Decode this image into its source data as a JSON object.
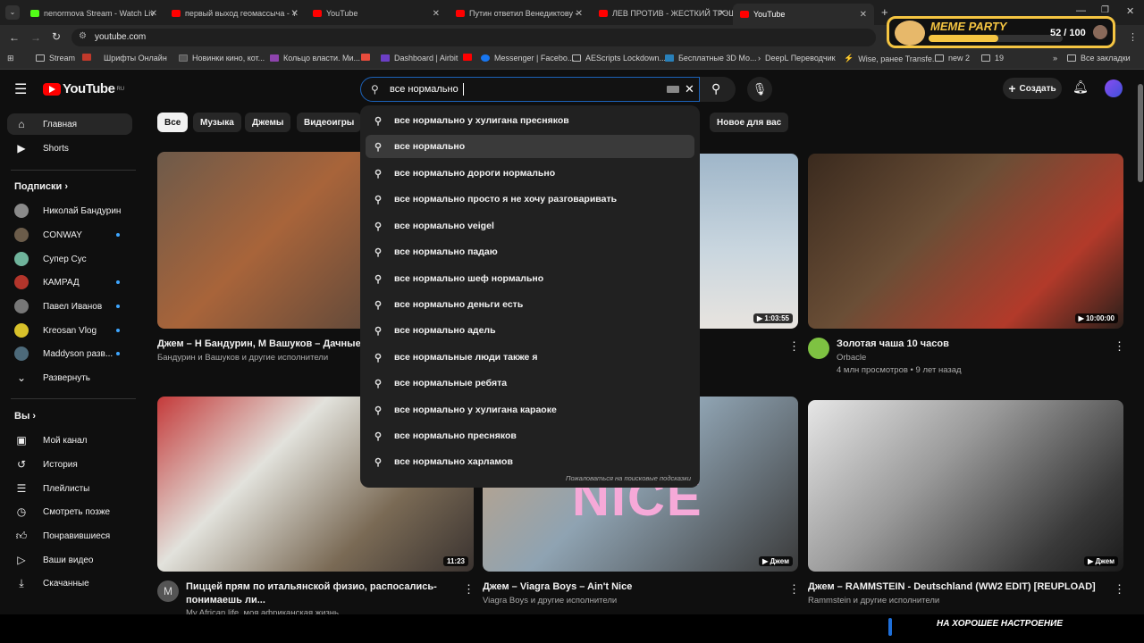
{
  "browser": {
    "tabs": [
      {
        "title": "nenormova Stream - Watch Liv",
        "active": false
      },
      {
        "title": "первый выход геомассыча - Y",
        "active": false
      },
      {
        "title": "YouTube",
        "active": false
      },
      {
        "title": "Путин ответил Венедиктову -",
        "active": false
      },
      {
        "title": "ЛЕВ ПРОТИВ - ЖЕСТКИЙ ТРЭШ",
        "active": false
      },
      {
        "title": "YouTube",
        "active": true
      }
    ],
    "url": "youtube.com",
    "bookmarks": [
      "Stream",
      "Шрифты Онлайн",
      "Новинки кино, кот...",
      "Кольцо власти. Ми...",
      "Dashboard | Airbit",
      "Messenger | Facebo...",
      "AEScripts Lockdown...",
      "Бесплатные 3D Мо...",
      "DeepL Переводчик",
      "Wise, ранее Transfe...",
      "new 2",
      "19"
    ],
    "all_bookmarks": "Все закладки"
  },
  "overlay": {
    "brand": "MEME PARTY",
    "score": "52 / 100",
    "bottom_text": "НА ХОРОШЕЕ НАСТРОЕНИЕ"
  },
  "header": {
    "logo": "YouTube",
    "region": "RU",
    "search_value": "все нормально",
    "create_label": "Создать"
  },
  "suggestions": {
    "items": [
      "все нормально у хулигана пресняков",
      "все нормально",
      "все нормально дороги нормально",
      "все нормально просто я не хочу разговаривать",
      "все нормально veigel",
      "все нормально падаю",
      "все нормально шеф нормально",
      "все нормально деньги есть",
      "все нормально адель",
      "все нормальные люди также я",
      "все нормальные ребята",
      "все нормально у хулигана караоке",
      "все нормально пресняков",
      "все нормально харламов"
    ],
    "report": "Пожаловаться на поисковые подсказки"
  },
  "sidebar": {
    "main": [
      {
        "label": "Главная",
        "icon": "home-icon"
      },
      {
        "label": "Shorts",
        "icon": "shorts-icon"
      }
    ],
    "subs_header": "Подписки",
    "subscriptions": [
      {
        "label": "Николай Бандурин",
        "color": "#8a8a8a",
        "dot": false
      },
      {
        "label": "CONWAY",
        "color": "#6b5c4a",
        "dot": true
      },
      {
        "label": "Супер Сус",
        "color": "#6fb39b",
        "dot": false
      },
      {
        "label": "КАМРАД",
        "color": "#b3352b",
        "dot": true
      },
      {
        "label": "Павел Иванов",
        "color": "#777777",
        "dot": true
      },
      {
        "label": "Kreosan Vlog",
        "color": "#d8c12a",
        "dot": true
      },
      {
        "label": "Maddyson разв...",
        "color": "#4d6a7a",
        "dot": true
      }
    ],
    "expand": "Развернуть",
    "you_header": "Вы",
    "you_items": [
      {
        "label": "Мой канал",
        "icon": "my-channel-icon"
      },
      {
        "label": "История",
        "icon": "history-icon"
      },
      {
        "label": "Плейлисты",
        "icon": "playlists-icon"
      },
      {
        "label": "Смотреть позже",
        "icon": "watch-later-icon"
      },
      {
        "label": "Понравившиеся",
        "icon": "liked-icon"
      },
      {
        "label": "Ваши видео",
        "icon": "your-videos-icon"
      },
      {
        "label": "Скачанные",
        "icon": "downloads-icon"
      }
    ]
  },
  "chips": [
    "Все",
    "Музыка",
    "Джемы",
    "Видеоигры",
    "Новое для вас"
  ],
  "videos": {
    "row1": [
      {
        "title": "Джем – Н Бандурин, М Вашуков – Дачные ча",
        "channel": "Бандурин и Вашуков и другие исполнители",
        "stats": "",
        "duration": ""
      },
      {
        "title": "",
        "channel": "",
        "stats": "",
        "duration": "1:03:55"
      },
      {
        "title": "Золотая чаша 10 часов",
        "channel": "Orbacle",
        "stats": "4 млн просмотров • 9 лет назад",
        "duration": "10:00:00"
      }
    ],
    "row2": [
      {
        "title": "Пиццей прям по итальянской физио, распосались-",
        "title2": "понимаешь ли...",
        "channel": "My African life, моя африканская жизнь",
        "duration": "11:23"
      },
      {
        "title": "Джем – Viagra Boys – Ain't Nice",
        "channel": "Viagra Boys и другие исполнители",
        "duration": "Джем"
      },
      {
        "title": "Джем – RAMMSTEIN - Deutschland (WW2 EDIT) [REUPLOAD]",
        "channel": "Rammstein и другие исполнители",
        "duration": "Джем"
      }
    ]
  }
}
